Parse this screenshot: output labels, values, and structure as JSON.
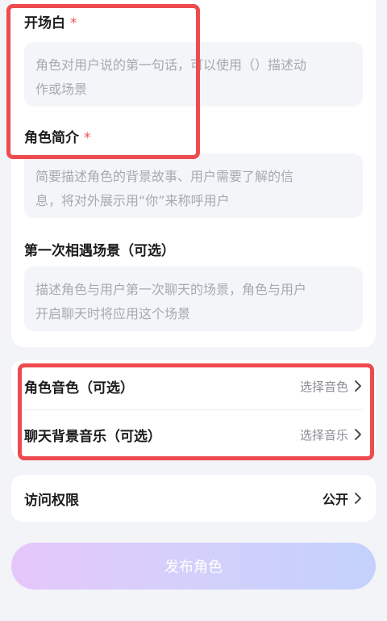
{
  "opening": {
    "label": "开场白",
    "required_mark": "*",
    "placeholder_line1": "角色对用户说的第一句话，可以使用（）描述动",
    "placeholder_line2": "作或场景"
  },
  "intro": {
    "label": "角色简介",
    "required_mark": "*",
    "placeholder_line1": "简要描述角色的背景故事、用户需要了解的信",
    "placeholder_line2": "息，将对外展示用“你”来称呼用户"
  },
  "first_meet": {
    "label": "第一次相遇场景（可选）",
    "placeholder_line1": "描述角色与用户第一次聊天的场景，角色与用户",
    "placeholder_line2": "开启聊天时将应用这个场景"
  },
  "voice": {
    "label": "角色音色（可选）",
    "value": "选择音色"
  },
  "music": {
    "label": "聊天背景音乐（可选）",
    "value": "选择音乐"
  },
  "access": {
    "label": "访问权限",
    "value": "公开"
  },
  "publish": {
    "label": "发布角色"
  },
  "colors": {
    "highlight_red": "#ee4b4f",
    "required_star": "#f0524f",
    "publish_gradient_start": "#e5c6fb",
    "publish_gradient_end": "#c3d1fa"
  },
  "icons": {
    "row_chevron": "chevron-right-icon"
  }
}
